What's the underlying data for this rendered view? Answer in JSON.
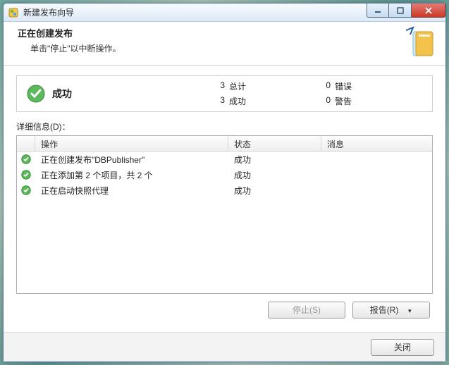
{
  "window": {
    "title": "新建发布向导"
  },
  "header": {
    "title": "正在创建发布",
    "subtitle": "单击\"停止\"以中断操作。"
  },
  "summary": {
    "status": "成功",
    "total_count": "3",
    "total_label": "总计",
    "success_count": "3",
    "success_label": "成功",
    "error_count": "0",
    "error_label": "错误",
    "warning_count": "0",
    "warning_label": "警告"
  },
  "details_label": "详细信息(D)：",
  "columns": {
    "icon": "",
    "op": "操作",
    "status": "状态",
    "msg": "消息"
  },
  "rows": [
    {
      "op": "正在创建发布\"DBPublisher\"",
      "status": "成功",
      "msg": ""
    },
    {
      "op": "正在添加第 2 个项目，共 2 个",
      "status": "成功",
      "msg": ""
    },
    {
      "op": "正在启动快照代理",
      "status": "成功",
      "msg": ""
    }
  ],
  "buttons": {
    "stop": "停止(S)",
    "report": "报告(R)",
    "close": "关闭"
  }
}
